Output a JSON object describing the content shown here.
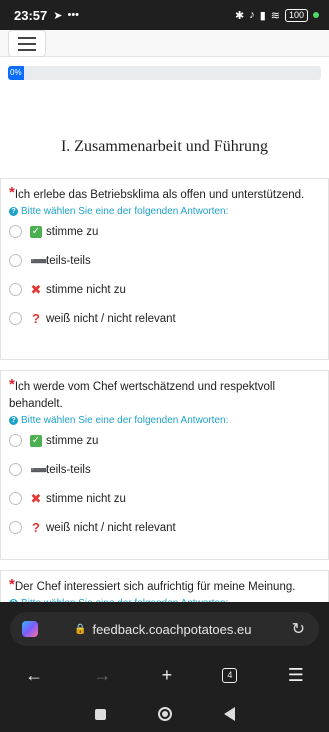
{
  "status": {
    "time": "23:57",
    "battery": "100"
  },
  "survey": {
    "progress_label": "0%",
    "progress_value": 0,
    "group_title": "I. Zusammenarbeit und Führung",
    "hint": "Bitte wählen Sie eine der folgenden Antworten:",
    "answers": [
      "stimme zu",
      "teils-teils",
      "stimme nicht zu",
      "weiß nicht / nicht relevant"
    ],
    "questions": [
      {
        "text": "Ich erlebe das Betriebsklima als offen und unterstützend."
      },
      {
        "text": "Ich werde vom Chef wertschätzend und respektvoll behandelt."
      },
      {
        "text": "Der Chef interessiert sich aufrichtig für meine Meinung."
      }
    ]
  },
  "browser": {
    "url": "feedback.coachpotatoes.eu",
    "tab_count": "4"
  },
  "icons": {
    "accent": "#0d6efd",
    "hint_color": "#1fa2c9",
    "required_color": "#d9232e"
  }
}
